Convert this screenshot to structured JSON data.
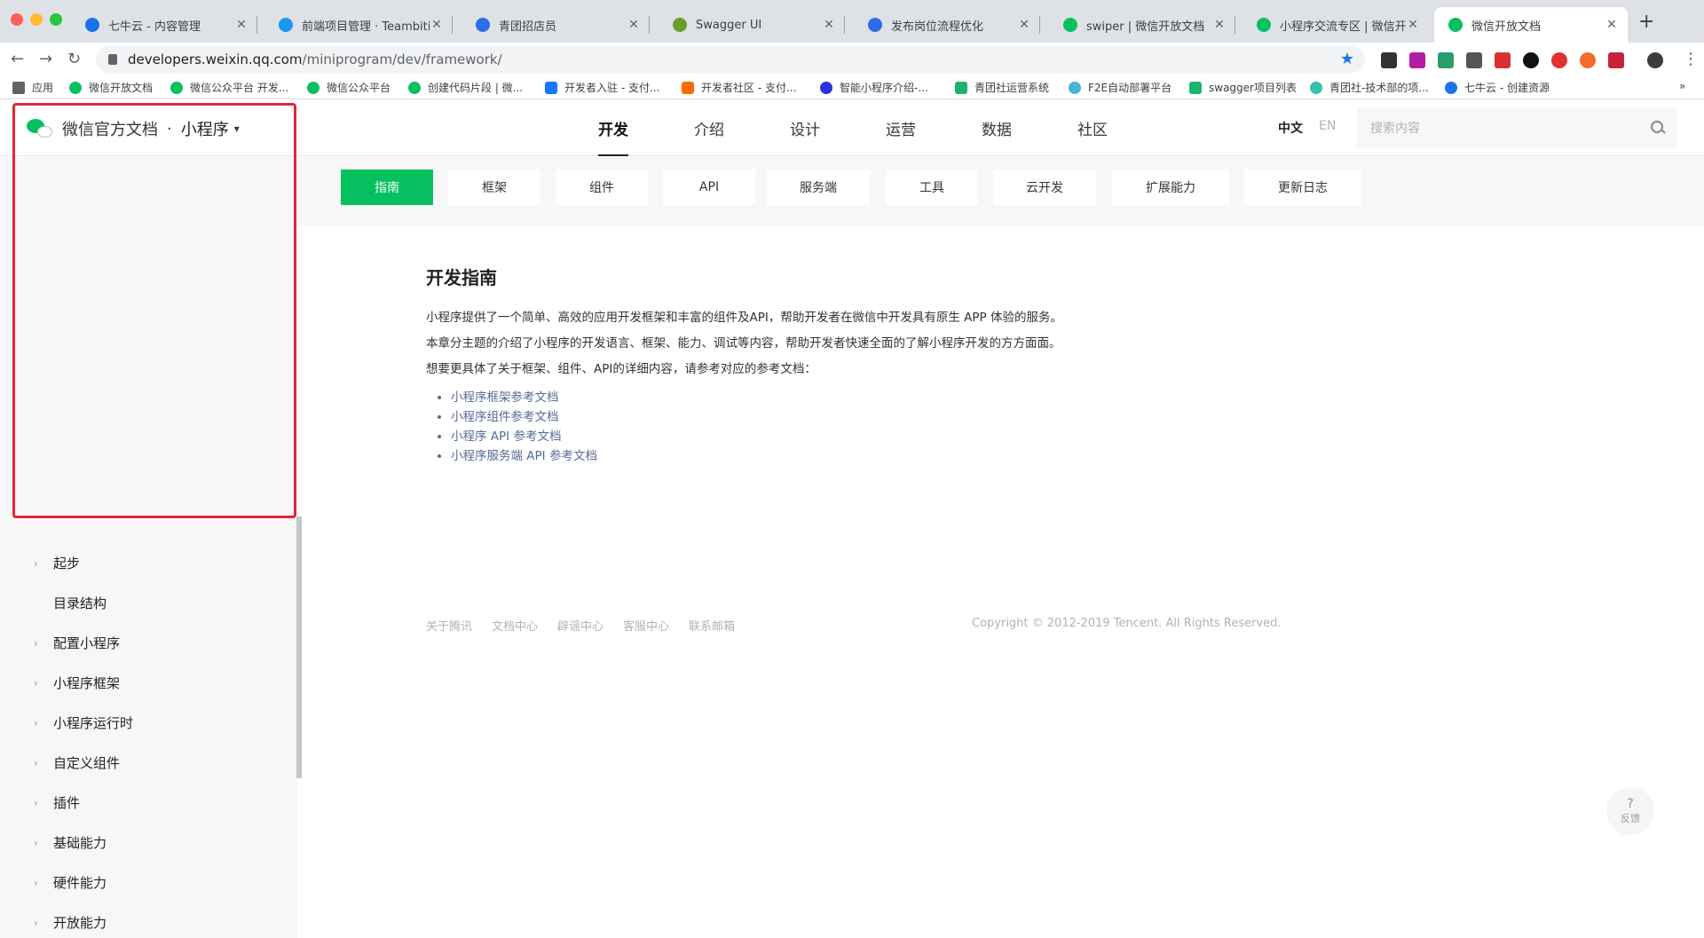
{
  "browser": {
    "tabs": [
      {
        "title": "七牛云 - 内容管理",
        "favicon_color": "#1a73e8"
      },
      {
        "title": "前端项目管理 · Teambition",
        "favicon_color": "#1d96f2"
      },
      {
        "title": "青团招店员",
        "favicon_color": "#2b6de8"
      },
      {
        "title": "Swagger UI",
        "favicon_color": "#6a9e2b"
      },
      {
        "title": "发布岗位流程优化",
        "favicon_color": "#2b6de8"
      },
      {
        "title": "swiper | 微信开放文档",
        "favicon_color": "#07c160"
      },
      {
        "title": "小程序交流专区 | 微信开放社",
        "favicon_color": "#07c160"
      },
      {
        "title": "微信开放文档",
        "favicon_color": "#07c160"
      }
    ],
    "url_host": "developers.weixin.qq.com",
    "url_path": "/miniprogram/dev/framework/",
    "bookmarks": [
      {
        "label": "应用",
        "color": "#5f6368"
      },
      {
        "label": "微信开放文档",
        "color": "#07c160"
      },
      {
        "label": "微信公众平台 开发...",
        "color": "#07c160"
      },
      {
        "label": "微信公众平台",
        "color": "#07c160"
      },
      {
        "label": "创建代码片段 | 微...",
        "color": "#07c160"
      },
      {
        "label": "开发者入驻 - 支付...",
        "color": "#1677ff"
      },
      {
        "label": "开发者社区 - 支付...",
        "color": "#ff6a00"
      },
      {
        "label": "智能小程序介绍-...",
        "color": "#2932e1"
      },
      {
        "label": "青团社运营系统",
        "color": "#1bb46f"
      },
      {
        "label": "F2E自动部署平台",
        "color": "#4ab3d4"
      },
      {
        "label": "swagger项目列表",
        "color": "#1bb46f"
      },
      {
        "label": "青团社-技术部的项...",
        "color": "#35c0b0"
      },
      {
        "label": "七牛云 - 创建资源",
        "color": "#1a73e8"
      }
    ],
    "more": "»"
  },
  "header": {
    "logo_text": "微信官方文档",
    "dot": "·",
    "product": "小程序",
    "nav": [
      "开发",
      "介绍",
      "设计",
      "运营",
      "数据",
      "社区"
    ],
    "lang_zh": "中文",
    "lang_en": "EN",
    "search_placeholder": "搜索内容"
  },
  "subnav": [
    "指南",
    "框架",
    "组件",
    "API",
    "服务端",
    "工具",
    "云开发",
    "扩展能力",
    "更新日志"
  ],
  "sidebar": {
    "items": [
      {
        "label": "起步",
        "arrow": "›"
      },
      {
        "label": "目录结构",
        "arrow": ""
      },
      {
        "label": "配置小程序",
        "arrow": "›"
      },
      {
        "label": "小程序框架",
        "arrow": "›"
      },
      {
        "label": "小程序运行时",
        "arrow": "›"
      },
      {
        "label": "自定义组件",
        "arrow": "›"
      },
      {
        "label": "插件",
        "arrow": "›"
      },
      {
        "label": "基础能力",
        "arrow": "›"
      },
      {
        "label": "硬件能力",
        "arrow": "›"
      },
      {
        "label": "开放能力",
        "arrow": "›"
      }
    ]
  },
  "content": {
    "title": "开发指南",
    "paragraphs": [
      "小程序提供了一个简单、高效的应用开发框架和丰富的组件及API，帮助开发者在微信中开发具有原生 APP 体验的服务。",
      "本章分主题的介绍了小程序的开发语言、框架、能力、调试等内容，帮助开发者快速全面的了解小程序开发的方方面面。",
      "想要更具体了关于框架、组件、API的详细内容，请参考对应的参考文档："
    ],
    "links": [
      "小程序框架参考文档",
      "小程序组件参考文档",
      "小程序 API 参考文档",
      "小程序服务端 API 参考文档"
    ]
  },
  "footer": {
    "links": [
      "关于腾讯",
      "文档中心",
      "辟谣中心",
      "客服中心",
      "联系邮箱"
    ],
    "copyright": "Copyright © 2012-2019 Tencent. All Rights Reserved."
  },
  "feedback": {
    "icon": "?",
    "label": "反馈"
  },
  "colors": {
    "brand_green": "#07c160",
    "link": "#576b95",
    "highlight_border": "#e0283a"
  }
}
